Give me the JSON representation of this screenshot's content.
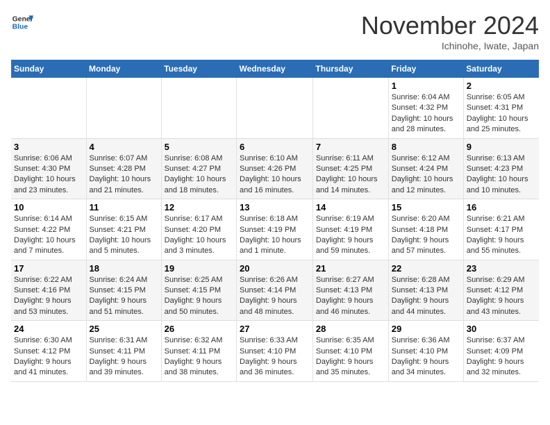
{
  "header": {
    "logo_line1": "General",
    "logo_line2": "Blue",
    "month_title": "November 2024",
    "location": "Ichinohe, Iwate, Japan"
  },
  "days_of_week": [
    "Sunday",
    "Monday",
    "Tuesday",
    "Wednesday",
    "Thursday",
    "Friday",
    "Saturday"
  ],
  "weeks": [
    [
      {
        "day": "",
        "info": ""
      },
      {
        "day": "",
        "info": ""
      },
      {
        "day": "",
        "info": ""
      },
      {
        "day": "",
        "info": ""
      },
      {
        "day": "",
        "info": ""
      },
      {
        "day": "1",
        "info": "Sunrise: 6:04 AM\nSunset: 4:32 PM\nDaylight: 10 hours and 28 minutes."
      },
      {
        "day": "2",
        "info": "Sunrise: 6:05 AM\nSunset: 4:31 PM\nDaylight: 10 hours and 25 minutes."
      }
    ],
    [
      {
        "day": "3",
        "info": "Sunrise: 6:06 AM\nSunset: 4:30 PM\nDaylight: 10 hours and 23 minutes."
      },
      {
        "day": "4",
        "info": "Sunrise: 6:07 AM\nSunset: 4:28 PM\nDaylight: 10 hours and 21 minutes."
      },
      {
        "day": "5",
        "info": "Sunrise: 6:08 AM\nSunset: 4:27 PM\nDaylight: 10 hours and 18 minutes."
      },
      {
        "day": "6",
        "info": "Sunrise: 6:10 AM\nSunset: 4:26 PM\nDaylight: 10 hours and 16 minutes."
      },
      {
        "day": "7",
        "info": "Sunrise: 6:11 AM\nSunset: 4:25 PM\nDaylight: 10 hours and 14 minutes."
      },
      {
        "day": "8",
        "info": "Sunrise: 6:12 AM\nSunset: 4:24 PM\nDaylight: 10 hours and 12 minutes."
      },
      {
        "day": "9",
        "info": "Sunrise: 6:13 AM\nSunset: 4:23 PM\nDaylight: 10 hours and 10 minutes."
      }
    ],
    [
      {
        "day": "10",
        "info": "Sunrise: 6:14 AM\nSunset: 4:22 PM\nDaylight: 10 hours and 7 minutes."
      },
      {
        "day": "11",
        "info": "Sunrise: 6:15 AM\nSunset: 4:21 PM\nDaylight: 10 hours and 5 minutes."
      },
      {
        "day": "12",
        "info": "Sunrise: 6:17 AM\nSunset: 4:20 PM\nDaylight: 10 hours and 3 minutes."
      },
      {
        "day": "13",
        "info": "Sunrise: 6:18 AM\nSunset: 4:19 PM\nDaylight: 10 hours and 1 minute."
      },
      {
        "day": "14",
        "info": "Sunrise: 6:19 AM\nSunset: 4:19 PM\nDaylight: 9 hours and 59 minutes."
      },
      {
        "day": "15",
        "info": "Sunrise: 6:20 AM\nSunset: 4:18 PM\nDaylight: 9 hours and 57 minutes."
      },
      {
        "day": "16",
        "info": "Sunrise: 6:21 AM\nSunset: 4:17 PM\nDaylight: 9 hours and 55 minutes."
      }
    ],
    [
      {
        "day": "17",
        "info": "Sunrise: 6:22 AM\nSunset: 4:16 PM\nDaylight: 9 hours and 53 minutes."
      },
      {
        "day": "18",
        "info": "Sunrise: 6:24 AM\nSunset: 4:15 PM\nDaylight: 9 hours and 51 minutes."
      },
      {
        "day": "19",
        "info": "Sunrise: 6:25 AM\nSunset: 4:15 PM\nDaylight: 9 hours and 50 minutes."
      },
      {
        "day": "20",
        "info": "Sunrise: 6:26 AM\nSunset: 4:14 PM\nDaylight: 9 hours and 48 minutes."
      },
      {
        "day": "21",
        "info": "Sunrise: 6:27 AM\nSunset: 4:13 PM\nDaylight: 9 hours and 46 minutes."
      },
      {
        "day": "22",
        "info": "Sunrise: 6:28 AM\nSunset: 4:13 PM\nDaylight: 9 hours and 44 minutes."
      },
      {
        "day": "23",
        "info": "Sunrise: 6:29 AM\nSunset: 4:12 PM\nDaylight: 9 hours and 43 minutes."
      }
    ],
    [
      {
        "day": "24",
        "info": "Sunrise: 6:30 AM\nSunset: 4:12 PM\nDaylight: 9 hours and 41 minutes."
      },
      {
        "day": "25",
        "info": "Sunrise: 6:31 AM\nSunset: 4:11 PM\nDaylight: 9 hours and 39 minutes."
      },
      {
        "day": "26",
        "info": "Sunrise: 6:32 AM\nSunset: 4:11 PM\nDaylight: 9 hours and 38 minutes."
      },
      {
        "day": "27",
        "info": "Sunrise: 6:33 AM\nSunset: 4:10 PM\nDaylight: 9 hours and 36 minutes."
      },
      {
        "day": "28",
        "info": "Sunrise: 6:35 AM\nSunset: 4:10 PM\nDaylight: 9 hours and 35 minutes."
      },
      {
        "day": "29",
        "info": "Sunrise: 6:36 AM\nSunset: 4:10 PM\nDaylight: 9 hours and 34 minutes."
      },
      {
        "day": "30",
        "info": "Sunrise: 6:37 AM\nSunset: 4:09 PM\nDaylight: 9 hours and 32 minutes."
      }
    ]
  ]
}
